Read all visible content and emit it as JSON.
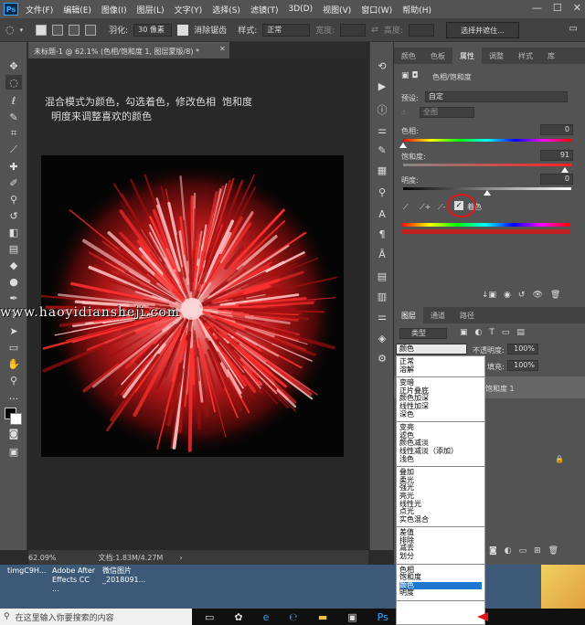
{
  "menubar": {
    "logo": "Ps",
    "items": [
      "文件(F)",
      "编辑(E)",
      "图像(I)",
      "图层(L)",
      "文字(Y)",
      "选择(S)",
      "滤镜(T)",
      "3D(D)",
      "视图(V)",
      "窗口(W)",
      "帮助(H)"
    ],
    "window_controls": [
      "—",
      "☐",
      "✕"
    ]
  },
  "options": {
    "feather_label": "羽化:",
    "feather_value": "30 像素",
    "antialias_label": "消除锯齿",
    "style_label": "样式:",
    "style_value": "正常",
    "width_label": "宽度:",
    "height_label": "高度:",
    "select_mask": "选择并遮住..."
  },
  "document": {
    "tab_title": "未标题-1 @ 62.1% (色相/饱和度 1, 图层蒙版/8) *",
    "overlay_text": "混合模式为颜色，勾选着色，修改色相  饱和度\n  明度来调整喜欢的颜色",
    "watermark": "www.haoyidiansheji.com",
    "zoom": "62.09%",
    "doc_size": "文档:1.83M/4.27M"
  },
  "properties": {
    "tabs": [
      "颜色",
      "色板",
      "属性",
      "调整",
      "样式",
      "库"
    ],
    "active_tab": "属性",
    "title": "色相/饱和度",
    "preset_label": "预设:",
    "preset_value": "自定",
    "channel": "全图",
    "hue_label": "色相:",
    "hue_value": "0",
    "hue_thumb_pct": 0,
    "sat_label": "饱和度:",
    "sat_value": "91",
    "sat_thumb_pct": 96,
    "light_label": "明度:",
    "light_value": "0",
    "light_thumb_pct": 50,
    "colorize_label": "着色"
  },
  "layers": {
    "tabs": [
      "图层",
      "通道",
      "路径"
    ],
    "kind_label": "类型",
    "blend_value": "颜色",
    "opacity_label": "不透明度:",
    "opacity_value": "100%",
    "fill_label": "填充:",
    "fill_value": "100%",
    "layer_name": "饱和度 1"
  },
  "blend_modes": [
    [
      "正常",
      "溶解"
    ],
    [
      "变暗",
      "正片叠底",
      "颜色加深",
      "线性加深",
      "深色"
    ],
    [
      "变亮",
      "滤色",
      "颜色减淡",
      "线性减淡（添加）",
      "浅色"
    ],
    [
      "叠加",
      "柔光",
      "强光",
      "亮光",
      "线性光",
      "点光",
      "实色混合"
    ],
    [
      "差值",
      "排除",
      "减去",
      "划分"
    ],
    [
      "色相",
      "饱和度",
      "颜色",
      "明度"
    ]
  ],
  "desktop": {
    "icons": [
      "timgC9H...",
      "Adobe After Effects CC ...",
      "微信图片_2018091..."
    ]
  },
  "taskbar": {
    "search_placeholder": "在这里输入你要搜索的内容"
  }
}
